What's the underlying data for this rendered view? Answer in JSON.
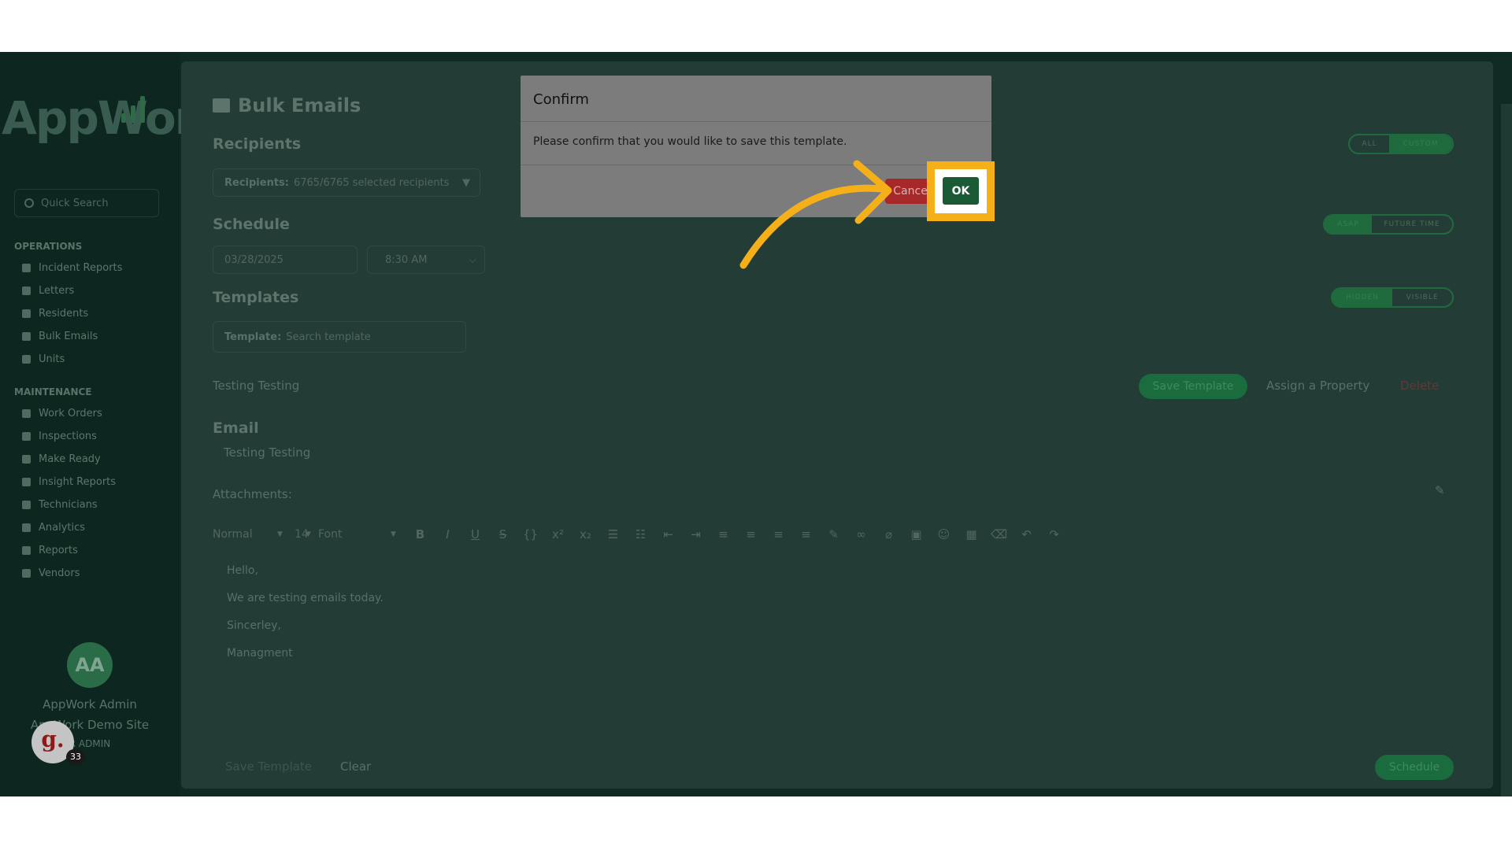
{
  "sidebar": {
    "logo_text": "AppWork",
    "search_placeholder": "Quick Search",
    "sections": [
      {
        "title": "OPERATIONS",
        "items": [
          "Incident Reports",
          "Letters",
          "Residents",
          "Bulk Emails",
          "Units"
        ]
      },
      {
        "title": "MAINTENANCE",
        "items": [
          "Work Orders",
          "Inspections",
          "Make Ready",
          "Insight Reports",
          "Technicians",
          "Analytics",
          "Reports",
          "Vendors"
        ]
      }
    ],
    "profile": {
      "initials": "AA",
      "name": "AppWork Admin",
      "site": "AppWork Demo Site",
      "role": "R ADMIN"
    }
  },
  "overlay_badge": {
    "letter": "g.",
    "count": "33"
  },
  "page": {
    "title": "Bulk Emails",
    "recipients": {
      "heading": "Recipients",
      "label": "Recipients:",
      "value": "6765/6765 selected recipients",
      "toggle": [
        "ALL",
        "CUSTOM"
      ]
    },
    "schedule": {
      "heading": "Schedule",
      "date": "03/28/2025",
      "time": "8:30 AM",
      "toggle": [
        "ASAP",
        "FUTURE TIME"
      ]
    },
    "templates": {
      "heading": "Templates",
      "label": "Template:",
      "placeholder": "Search template",
      "toggle": [
        "HIDDEN",
        "VISIBLE"
      ],
      "template_name": "Testing Testing",
      "save_label": "Save Template",
      "assign_label": "Assign a Property",
      "delete_label": "Delete"
    },
    "email": {
      "heading": "Email",
      "subject": "Testing Testing",
      "attachments_label": "Attachments:",
      "toolbar": {
        "style": "Normal",
        "size": "14",
        "font": "Font"
      },
      "body_lines": [
        "Hello,",
        "We are testing emails today.",
        "Sincerley,",
        "Managment"
      ]
    },
    "footer": {
      "save_template": "Save Template",
      "clear": "Clear",
      "schedule": "Schedule"
    }
  },
  "modal": {
    "title": "Confirm",
    "message": "Please confirm that you would like to save this template.",
    "cancel_label": "Cancel",
    "ok_label": "OK"
  },
  "colors": {
    "highlight": "#f5b019",
    "arrow": "#f5b019",
    "ok_button": "#1a5a35",
    "cancel_button": "#a72828"
  }
}
